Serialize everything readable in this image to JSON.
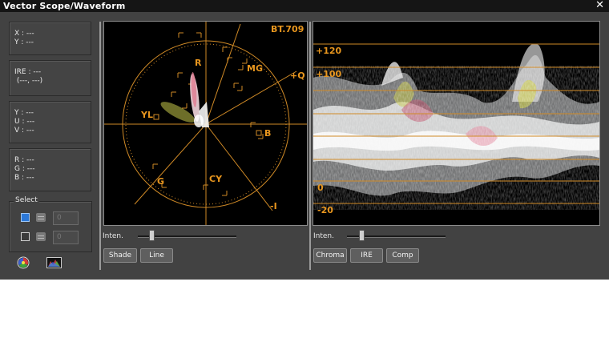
{
  "window": {
    "title": "Vector Scope/Waveform",
    "close_glyph": "✕"
  },
  "info": {
    "xy": [
      "X : ---",
      "Y : ---"
    ],
    "ire": [
      "IRE : ---",
      " (---, ---)"
    ],
    "yuv": [
      "Y : ---",
      "U : ---",
      "V : ---"
    ],
    "rgb": [
      "R : ---",
      "G : ---",
      "B : ---"
    ]
  },
  "select": {
    "label": "Select",
    "row1_value": "0",
    "row2_value": "0"
  },
  "vectorscope": {
    "standard": "BT.709",
    "targets": {
      "r": "R",
      "mg": "MG",
      "b": "B",
      "cy": "CY",
      "g": "G",
      "yl": "YL",
      "plus_q": "+Q",
      "minus_i": "-I"
    },
    "intensity_label": "Inten.",
    "intensity_level": 0.15,
    "buttons": [
      "Shade",
      "Line"
    ]
  },
  "waveform": {
    "scale": [
      "+120",
      "+100",
      "0",
      "-20"
    ],
    "intensity_label": "Inten.",
    "intensity_level": 0.15,
    "buttons": [
      "Chroma",
      "IRE",
      "Comp"
    ]
  },
  "icons": {
    "color_wheel": "color-wheel-icon",
    "histogram": "rgb-histogram-icon"
  },
  "colors": {
    "graticule": "#e0962a",
    "scope_bg": "#000000",
    "panel_bg": "#424242",
    "checkbox_on": "#2b78d8"
  }
}
